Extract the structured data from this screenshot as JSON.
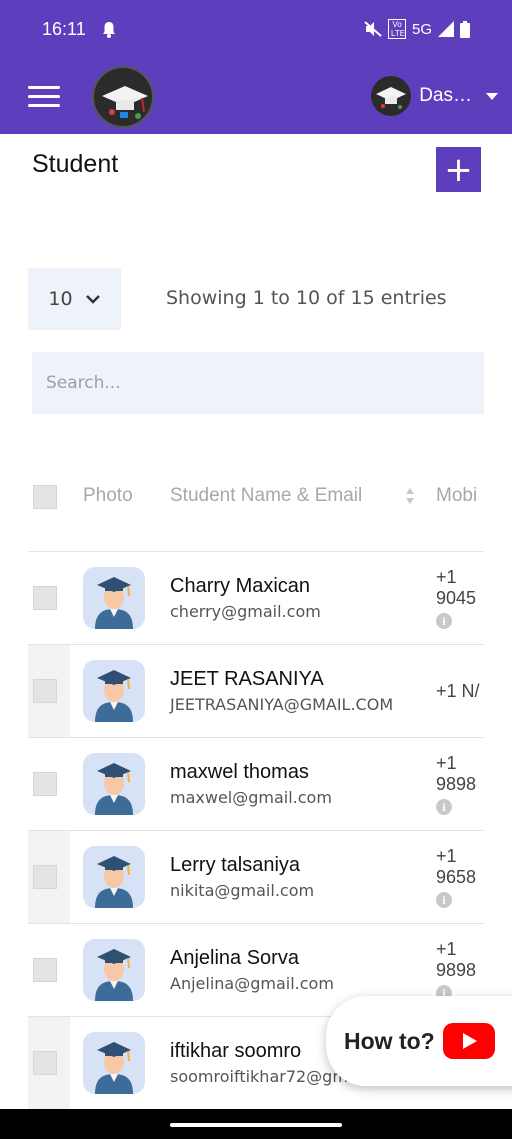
{
  "status_bar": {
    "time": "16:11",
    "network": "5G",
    "volte": "Vo LTE",
    "icons": [
      "notification-bell-icon",
      "mute-icon",
      "volte-icon",
      "signal-icon",
      "battery-icon"
    ]
  },
  "app_bar": {
    "username": "Das…",
    "icons": [
      "hamburger-menu-icon",
      "school-logo",
      "profile-avatar",
      "dropdown-caret-icon"
    ]
  },
  "page": {
    "title": "Student",
    "add_label": "+"
  },
  "table_controls": {
    "page_length": "10",
    "entries_info": "Showing 1 to 10 of 15 entries",
    "search_placeholder": "Search..."
  },
  "table": {
    "headers": {
      "photo": "Photo",
      "name_email": "Student Name & Email",
      "mobile": "Mobi"
    },
    "rows": [
      {
        "name": "Charry Maxican",
        "email": "cherry@gmail.com",
        "mobile_line1": "+1",
        "mobile_line2": "9045",
        "info": "i"
      },
      {
        "name": "JEET RASANIYA",
        "email": "JEETRASANIYA@GMAIL.COM",
        "mobile_line1": "+1 N/",
        "mobile_line2": "",
        "info": ""
      },
      {
        "name": "maxwel thomas",
        "email": "maxwel@gmail.com",
        "mobile_line1": "+1",
        "mobile_line2": "9898",
        "info": "i"
      },
      {
        "name": "Lerry talsaniya",
        "email": "nikita@gmail.com",
        "mobile_line1": "+1",
        "mobile_line2": "9658",
        "info": "i"
      },
      {
        "name": "Anjelina Sorva",
        "email": "Anjelina@gmail.com",
        "mobile_line1": "+1",
        "mobile_line2": "9898",
        "info": "i"
      },
      {
        "name": "iftikhar soomro",
        "email": "soomroiftikhar72@gm",
        "mobile_line1": "",
        "mobile_line2": "",
        "info": ""
      }
    ]
  },
  "help_widget": {
    "label": "How to?"
  },
  "colors": {
    "primary": "#5d3fbd",
    "input_bg": "#eef2f9",
    "youtube_red": "#ff0000"
  }
}
